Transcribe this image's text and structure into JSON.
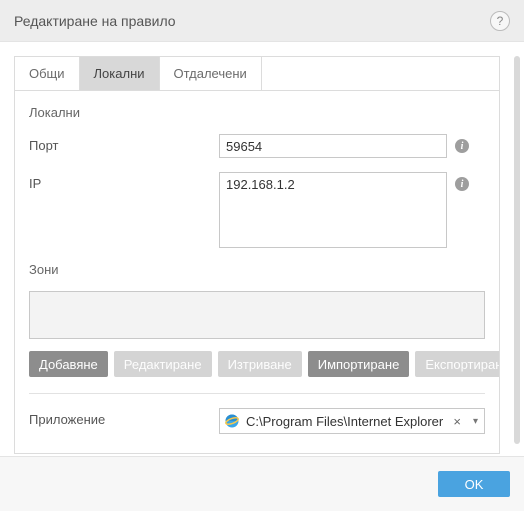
{
  "header": {
    "title": "Редактиране на правило",
    "help_glyph": "?"
  },
  "tabs": {
    "items": [
      {
        "label": "Общи"
      },
      {
        "label": "Локални"
      },
      {
        "label": "Отдалечени"
      }
    ],
    "active_index": 1
  },
  "section": {
    "title": "Локални",
    "port_label": "Порт",
    "port_value": "59654",
    "ip_label": "IP",
    "ip_value": "192.168.1.2",
    "info_glyph": "i"
  },
  "zones": {
    "label": "Зони",
    "buttons": {
      "add": "Добавяне",
      "edit": "Редактиране",
      "delete": "Изтриване",
      "import": "Импортиране",
      "export": "Експортиране"
    }
  },
  "application": {
    "label": "Приложение",
    "path": "C:\\Program Files\\Internet Explorer\\",
    "clear_glyph": "×",
    "chev_glyph": "▾"
  },
  "footer": {
    "ok": "OK"
  }
}
